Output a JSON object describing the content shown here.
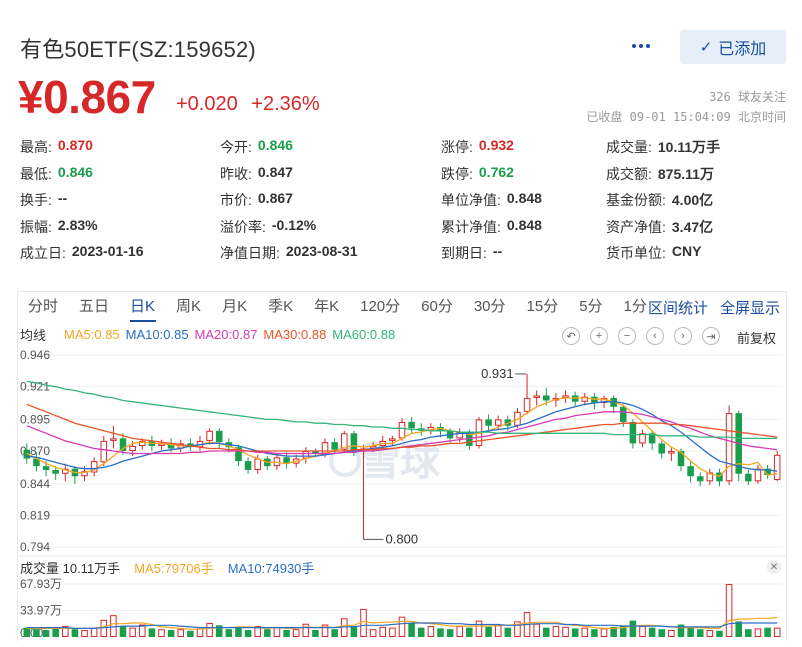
{
  "header": {
    "title": "有色50ETF(SZ:159652)",
    "follow_label": "已添加",
    "price": "¥0.867",
    "change": "+0.020",
    "change_pct": "+2.36%",
    "followers_count": "326",
    "followers_label": "球友关注",
    "status": "已收盘 09-01 15:04:09 北京时间"
  },
  "quote": {
    "rows": [
      [
        {
          "label": "最高:",
          "value": "0.870",
          "tone": "up"
        },
        {
          "label": "今开:",
          "value": "0.846",
          "tone": "down"
        },
        {
          "label": "涨停:",
          "value": "0.932",
          "tone": "up"
        },
        {
          "label": "成交量:",
          "value": "10.11万手",
          "tone": ""
        }
      ],
      [
        {
          "label": "最低:",
          "value": "0.846",
          "tone": "down"
        },
        {
          "label": "昨收:",
          "value": "0.847",
          "tone": ""
        },
        {
          "label": "跌停:",
          "value": "0.762",
          "tone": "down"
        },
        {
          "label": "成交额:",
          "value": "875.11万",
          "tone": ""
        }
      ],
      [
        {
          "label": "换手:",
          "value": "--",
          "tone": ""
        },
        {
          "label": "市价:",
          "value": "0.867",
          "tone": ""
        },
        {
          "label": "单位净值:",
          "value": "0.848",
          "tone": ""
        },
        {
          "label": "基金份额:",
          "value": "4.00亿",
          "tone": ""
        }
      ],
      [
        {
          "label": "振幅:",
          "value": "2.83%",
          "tone": ""
        },
        {
          "label": "溢价率:",
          "value": "-0.12%",
          "tone": ""
        },
        {
          "label": "累计净值:",
          "value": "0.848",
          "tone": ""
        },
        {
          "label": "资产净值:",
          "value": "3.47亿",
          "tone": ""
        }
      ],
      [
        {
          "label": "成立日:",
          "value": "2023-01-16",
          "tone": ""
        },
        {
          "label": "净值日期:",
          "value": "2023-08-31",
          "tone": ""
        },
        {
          "label": "到期日:",
          "value": "--",
          "tone": ""
        },
        {
          "label": "货币单位:",
          "value": "CNY",
          "tone": ""
        }
      ]
    ]
  },
  "tabs": {
    "items": [
      "分时",
      "五日",
      "日K",
      "周K",
      "月K",
      "季K",
      "年K",
      "120分",
      "60分",
      "30分",
      "15分",
      "5分",
      "1分"
    ],
    "active_index": 2,
    "right": [
      "区间统计",
      "全屏显示"
    ]
  },
  "ma_bar": {
    "label": "均线",
    "items": [
      {
        "text": "MA5:0.85",
        "color": "#f5a623"
      },
      {
        "text": "MA10:0.85",
        "color": "#2a6fc4"
      },
      {
        "text": "MA20:0.87",
        "color": "#d63bb3"
      },
      {
        "text": "MA30:0.88",
        "color": "#e8542a"
      },
      {
        "text": "MA60:0.88",
        "color": "#35b47c"
      }
    ],
    "adjust": "前复权"
  },
  "kline": {
    "y_ticks": [
      "0.946",
      "0.921",
      "0.895",
      "0.870",
      "0.844",
      "0.819",
      "0.794"
    ],
    "high_label": "0.931",
    "low_label": "0.800",
    "watermark": "雪球",
    "colors": {
      "up": "#d62828",
      "down": "#1a9e4b"
    }
  },
  "volume": {
    "label": "成交量 10.11万手",
    "ma5": "MA5:79706手",
    "ma10": "MA10:74930手",
    "y_ticks": [
      "67.93万",
      "33.97万",
      "0.00"
    ],
    "ma5_color": "#f5a623",
    "ma10_color": "#2a6fc4"
  },
  "chart_data": {
    "type": "candlestick",
    "y_range": [
      0.794,
      0.946
    ],
    "candles": [
      [
        0.871,
        0.864,
        0.876,
        0.86
      ],
      [
        0.864,
        0.858,
        0.869,
        0.854
      ],
      [
        0.858,
        0.855,
        0.862,
        0.85
      ],
      [
        0.855,
        0.852,
        0.858,
        0.847
      ],
      [
        0.852,
        0.856,
        0.86,
        0.846
      ],
      [
        0.856,
        0.85,
        0.858,
        0.844
      ],
      [
        0.85,
        0.854,
        0.858,
        0.846
      ],
      [
        0.853,
        0.862,
        0.865,
        0.85
      ],
      [
        0.861,
        0.878,
        0.882,
        0.858
      ],
      [
        0.878,
        0.88,
        0.89,
        0.872
      ],
      [
        0.88,
        0.87,
        0.884,
        0.867
      ],
      [
        0.87,
        0.874,
        0.878,
        0.866
      ],
      [
        0.874,
        0.878,
        0.88,
        0.871
      ],
      [
        0.878,
        0.874,
        0.882,
        0.87
      ],
      [
        0.874,
        0.876,
        0.879,
        0.871
      ],
      [
        0.876,
        0.872,
        0.88,
        0.869
      ],
      [
        0.872,
        0.876,
        0.879,
        0.869
      ],
      [
        0.876,
        0.873,
        0.88,
        0.87
      ],
      [
        0.873,
        0.878,
        0.882,
        0.87
      ],
      [
        0.878,
        0.886,
        0.888,
        0.875
      ],
      [
        0.886,
        0.877,
        0.888,
        0.872
      ],
      [
        0.877,
        0.873,
        0.88,
        0.869
      ],
      [
        0.873,
        0.862,
        0.875,
        0.858
      ],
      [
        0.862,
        0.855,
        0.865,
        0.852
      ],
      [
        0.855,
        0.864,
        0.867,
        0.852
      ],
      [
        0.864,
        0.858,
        0.866,
        0.855
      ],
      [
        0.858,
        0.865,
        0.868,
        0.855
      ],
      [
        0.865,
        0.86,
        0.869,
        0.856
      ],
      [
        0.86,
        0.864,
        0.867,
        0.857
      ],
      [
        0.864,
        0.87,
        0.873,
        0.86
      ],
      [
        0.87,
        0.868,
        0.872,
        0.865
      ],
      [
        0.868,
        0.877,
        0.88,
        0.865
      ],
      [
        0.877,
        0.871,
        0.88,
        0.868
      ],
      [
        0.871,
        0.884,
        0.886,
        0.869
      ],
      [
        0.884,
        0.87,
        0.886,
        0.866
      ],
      [
        0.87,
        0.872,
        0.875,
        0.8
      ],
      [
        0.872,
        0.874,
        0.877,
        0.869
      ],
      [
        0.874,
        0.878,
        0.882,
        0.871
      ],
      [
        0.878,
        0.88,
        0.882,
        0.874
      ],
      [
        0.88,
        0.893,
        0.896,
        0.878
      ],
      [
        0.893,
        0.888,
        0.897,
        0.884
      ],
      [
        0.888,
        0.886,
        0.892,
        0.882
      ],
      [
        0.886,
        0.889,
        0.892,
        0.883
      ],
      [
        0.889,
        0.886,
        0.892,
        0.881
      ],
      [
        0.886,
        0.88,
        0.888,
        0.876
      ],
      [
        0.88,
        0.885,
        0.888,
        0.877
      ],
      [
        0.885,
        0.874,
        0.887,
        0.871
      ],
      [
        0.874,
        0.895,
        0.897,
        0.872
      ],
      [
        0.895,
        0.89,
        0.899,
        0.886
      ],
      [
        0.89,
        0.895,
        0.898,
        0.887
      ],
      [
        0.895,
        0.89,
        0.898,
        0.886
      ],
      [
        0.89,
        0.901,
        0.904,
        0.888
      ],
      [
        0.901,
        0.912,
        0.931,
        0.899
      ],
      [
        0.912,
        0.914,
        0.918,
        0.906
      ],
      [
        0.914,
        0.91,
        0.92,
        0.906
      ],
      [
        0.91,
        0.912,
        0.916,
        0.905
      ],
      [
        0.912,
        0.914,
        0.918,
        0.908
      ],
      [
        0.914,
        0.909,
        0.917,
        0.905
      ],
      [
        0.909,
        0.913,
        0.916,
        0.906
      ],
      [
        0.913,
        0.908,
        0.916,
        0.903
      ],
      [
        0.908,
        0.912,
        0.914,
        0.904
      ],
      [
        0.912,
        0.905,
        0.914,
        0.9
      ],
      [
        0.905,
        0.893,
        0.907,
        0.889
      ],
      [
        0.893,
        0.876,
        0.895,
        0.872
      ],
      [
        0.876,
        0.884,
        0.887,
        0.873
      ],
      [
        0.884,
        0.876,
        0.886,
        0.871
      ],
      [
        0.876,
        0.868,
        0.878,
        0.864
      ],
      [
        0.868,
        0.87,
        0.873,
        0.862
      ],
      [
        0.87,
        0.858,
        0.872,
        0.854
      ],
      [
        0.858,
        0.85,
        0.862,
        0.845
      ],
      [
        0.85,
        0.846,
        0.853,
        0.842
      ],
      [
        0.846,
        0.853,
        0.856,
        0.843
      ],
      [
        0.853,
        0.846,
        0.856,
        0.842
      ],
      [
        0.846,
        0.9,
        0.906,
        0.843
      ],
      [
        0.9,
        0.852,
        0.902,
        0.846
      ],
      [
        0.852,
        0.846,
        0.855,
        0.843
      ],
      [
        0.846,
        0.856,
        0.859,
        0.844
      ],
      [
        0.856,
        0.851,
        0.859,
        0.848
      ],
      [
        0.847,
        0.867,
        0.87,
        0.846
      ]
    ],
    "ma5": [
      0.868,
      0.864,
      0.86,
      0.857,
      0.855,
      0.853,
      0.853,
      0.855,
      0.86,
      0.866,
      0.872,
      0.876,
      0.877,
      0.876,
      0.876,
      0.875,
      0.874,
      0.874,
      0.875,
      0.877,
      0.876,
      0.874,
      0.871,
      0.867,
      0.864,
      0.861,
      0.861,
      0.86,
      0.862,
      0.864,
      0.866,
      0.868,
      0.87,
      0.873,
      0.874,
      0.873,
      0.874,
      0.876,
      0.876,
      0.88,
      0.884,
      0.885,
      0.887,
      0.888,
      0.886,
      0.885,
      0.883,
      0.884,
      0.886,
      0.889,
      0.892,
      0.895,
      0.9,
      0.905,
      0.908,
      0.911,
      0.912,
      0.912,
      0.912,
      0.911,
      0.911,
      0.909,
      0.906,
      0.9,
      0.893,
      0.886,
      0.879,
      0.873,
      0.869,
      0.862,
      0.856,
      0.852,
      0.85,
      0.858,
      0.86,
      0.859,
      0.861,
      0.851,
      0.852
    ],
    "ma10": [
      0.866,
      0.865,
      0.863,
      0.861,
      0.859,
      0.857,
      0.856,
      0.856,
      0.857,
      0.859,
      0.862,
      0.864,
      0.866,
      0.868,
      0.87,
      0.871,
      0.872,
      0.874,
      0.875,
      0.876,
      0.876,
      0.875,
      0.874,
      0.872,
      0.87,
      0.868,
      0.867,
      0.866,
      0.866,
      0.866,
      0.866,
      0.867,
      0.868,
      0.869,
      0.87,
      0.871,
      0.872,
      0.873,
      0.874,
      0.876,
      0.878,
      0.879,
      0.881,
      0.882,
      0.883,
      0.884,
      0.884,
      0.885,
      0.886,
      0.887,
      0.888,
      0.89,
      0.892,
      0.895,
      0.898,
      0.901,
      0.903,
      0.905,
      0.907,
      0.908,
      0.909,
      0.909,
      0.908,
      0.906,
      0.903,
      0.899,
      0.894,
      0.89,
      0.885,
      0.879,
      0.873,
      0.867,
      0.862,
      0.86,
      0.858,
      0.856,
      0.855,
      0.855,
      0.854
    ],
    "ma20": [
      0.89,
      0.887,
      0.884,
      0.881,
      0.878,
      0.876,
      0.874,
      0.872,
      0.871,
      0.87,
      0.869,
      0.868,
      0.868,
      0.868,
      0.868,
      0.868,
      0.868,
      0.869,
      0.869,
      0.87,
      0.87,
      0.87,
      0.87,
      0.87,
      0.869,
      0.869,
      0.868,
      0.868,
      0.868,
      0.868,
      0.868,
      0.868,
      0.868,
      0.869,
      0.869,
      0.87,
      0.87,
      0.871,
      0.872,
      0.873,
      0.874,
      0.875,
      0.876,
      0.877,
      0.878,
      0.879,
      0.88,
      0.881,
      0.882,
      0.884,
      0.885,
      0.887,
      0.889,
      0.891,
      0.893,
      0.895,
      0.896,
      0.898,
      0.899,
      0.9,
      0.901,
      0.901,
      0.901,
      0.9,
      0.899,
      0.897,
      0.895,
      0.893,
      0.89,
      0.888,
      0.885,
      0.882,
      0.88,
      0.878,
      0.876,
      0.874,
      0.873,
      0.872,
      0.871
    ],
    "ma30": [
      0.907,
      0.904,
      0.901,
      0.898,
      0.895,
      0.892,
      0.89,
      0.888,
      0.886,
      0.884,
      0.882,
      0.88,
      0.879,
      0.878,
      0.877,
      0.876,
      0.875,
      0.874,
      0.873,
      0.872,
      0.872,
      0.871,
      0.871,
      0.87,
      0.87,
      0.87,
      0.87,
      0.87,
      0.87,
      0.87,
      0.87,
      0.87,
      0.87,
      0.87,
      0.871,
      0.871,
      0.871,
      0.872,
      0.872,
      0.873,
      0.873,
      0.874,
      0.874,
      0.875,
      0.876,
      0.876,
      0.877,
      0.878,
      0.879,
      0.88,
      0.881,
      0.882,
      0.883,
      0.884,
      0.885,
      0.886,
      0.887,
      0.888,
      0.889,
      0.89,
      0.891,
      0.891,
      0.892,
      0.892,
      0.892,
      0.892,
      0.892,
      0.891,
      0.891,
      0.89,
      0.889,
      0.888,
      0.887,
      0.886,
      0.885,
      0.884,
      0.883,
      0.882,
      0.881
    ],
    "ma60": [
      0.925,
      0.924,
      0.922,
      0.921,
      0.919,
      0.918,
      0.916,
      0.915,
      0.913,
      0.912,
      0.91,
      0.909,
      0.908,
      0.907,
      0.906,
      0.905,
      0.904,
      0.903,
      0.902,
      0.901,
      0.9,
      0.899,
      0.898,
      0.897,
      0.896,
      0.895,
      0.895,
      0.894,
      0.893,
      0.893,
      0.892,
      0.892,
      0.891,
      0.891,
      0.89,
      0.89,
      0.889,
      0.889,
      0.888,
      0.888,
      0.887,
      0.887,
      0.886,
      0.886,
      0.886,
      0.885,
      0.885,
      0.885,
      0.885,
      0.884,
      0.884,
      0.884,
      0.884,
      0.884,
      0.884,
      0.884,
      0.884,
      0.884,
      0.884,
      0.884,
      0.884,
      0.883,
      0.883,
      0.883,
      0.883,
      0.883,
      0.882,
      0.882,
      0.882,
      0.882,
      0.881,
      0.881,
      0.881,
      0.881,
      0.88,
      0.88,
      0.88,
      0.88,
      0.88
    ],
    "volume": [
      12,
      10,
      9,
      11,
      14,
      10,
      9,
      12,
      22,
      28,
      14,
      12,
      16,
      11,
      10,
      9,
      10,
      8,
      11,
      18,
      15,
      10,
      12,
      9,
      14,
      10,
      13,
      9,
      10,
      17,
      9,
      16,
      10,
      24,
      14,
      36,
      10,
      13,
      12,
      26,
      18,
      12,
      14,
      11,
      10,
      14,
      12,
      21,
      13,
      15,
      12,
      20,
      32,
      17,
      12,
      14,
      13,
      11,
      12,
      10,
      11,
      13,
      15,
      21,
      14,
      12,
      10,
      9,
      16,
      12,
      10,
      9,
      8,
      68,
      20,
      10,
      11,
      12,
      12
    ],
    "volume_ma5": [
      11,
      11,
      11,
      11,
      11,
      11,
      11,
      11,
      13,
      17,
      17,
      18,
      18,
      16,
      13,
      12,
      11,
      10,
      10,
      11,
      12,
      12,
      13,
      13,
      12,
      11,
      12,
      11,
      11,
      13,
      12,
      13,
      12,
      15,
      15,
      20,
      18,
      19,
      19,
      20,
      20,
      18,
      17,
      16,
      14,
      14,
      14,
      14,
      14,
      15,
      15,
      16,
      18,
      19,
      19,
      19,
      16,
      15,
      14,
      12,
      11,
      11,
      12,
      14,
      15,
      15,
      14,
      13,
      12,
      12,
      12,
      11,
      11,
      21,
      23,
      23,
      24,
      24,
      25
    ],
    "volume_ma10": [
      12,
      12,
      12,
      12,
      12,
      11,
      11,
      11,
      12,
      13,
      14,
      14,
      14,
      15,
      15,
      15,
      14,
      13,
      12,
      12,
      12,
      12,
      12,
      12,
      12,
      12,
      12,
      12,
      12,
      12,
      12,
      12,
      12,
      13,
      13,
      15,
      15,
      15,
      16,
      17,
      18,
      18,
      18,
      18,
      17,
      17,
      16,
      16,
      16,
      16,
      15,
      15,
      16,
      17,
      17,
      17,
      16,
      16,
      15,
      15,
      15,
      15,
      14,
      14,
      14,
      14,
      14,
      13,
      13,
      13,
      13,
      13,
      13,
      17,
      18,
      18,
      18,
      18,
      18
    ],
    "volume_y_range": [
      0,
      67.93
    ]
  }
}
